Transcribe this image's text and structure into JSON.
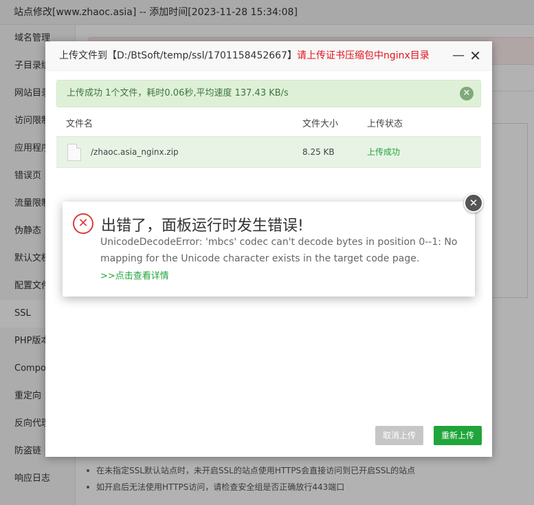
{
  "window": {
    "title": "站点修改[www.zhaoc.asia] -- 添加时间[2023-11-28 15:34:08]"
  },
  "sidebar": {
    "items": [
      {
        "label": "域名管理"
      },
      {
        "label": "子目录绑"
      },
      {
        "label": "网站目录"
      },
      {
        "label": "访问限制"
      },
      {
        "label": "应用程序"
      },
      {
        "label": "错误页"
      },
      {
        "label": "流量限制"
      },
      {
        "label": "伪静态"
      },
      {
        "label": "默认文档"
      },
      {
        "label": "配置文件"
      },
      {
        "label": "SSL",
        "active": true
      },
      {
        "label": "PHP版本"
      },
      {
        "label": "Compos"
      },
      {
        "label": "重定向"
      },
      {
        "label": "反向代理"
      },
      {
        "label": "防盗链"
      },
      {
        "label": "响应日志"
      }
    ]
  },
  "tips": [
    "在未指定SSL默认站点时，未开启SSL的站点使用HTTPS会直接访问到已开启SSL的站点",
    "如开启后无法使用HTTPS访问，请检查安全组是否正确放行443端口"
  ],
  "upload_dialog": {
    "title_prefix": "上传文件到【D:/BtSoft/temp/ssl/1701158452667】",
    "title_warning": "请上传证书压缩包中nginx目录",
    "minimize_icon": "—",
    "close_icon": "✕",
    "success_message": "上传成功 1个文件，耗时0.06秒,平均速度 137.43 KB/s",
    "success_close_icon": "✕",
    "columns": {
      "name": "文件名",
      "size": "文件大小",
      "status": "上传状态"
    },
    "files": [
      {
        "name": "/zhaoc.asia_nginx.zip",
        "size": "8.25 KB",
        "status": "上传成功"
      }
    ],
    "cancel_label": "取消上传",
    "reupload_label": "重新上传"
  },
  "error_popup": {
    "icon": "✕",
    "title": "出错了，面板运行时发生错误!",
    "message": "UnicodeDecodeError: 'mbcs' codec can't decode bytes in position 0--1: No mapping for the Unicode character exists in the target code page.",
    "details_link": ">>点击查看详情",
    "close_icon": "✕"
  },
  "colors": {
    "brand_green": "#20a53a",
    "warning_red": "#e0141e",
    "error_red": "#e03a3a"
  }
}
